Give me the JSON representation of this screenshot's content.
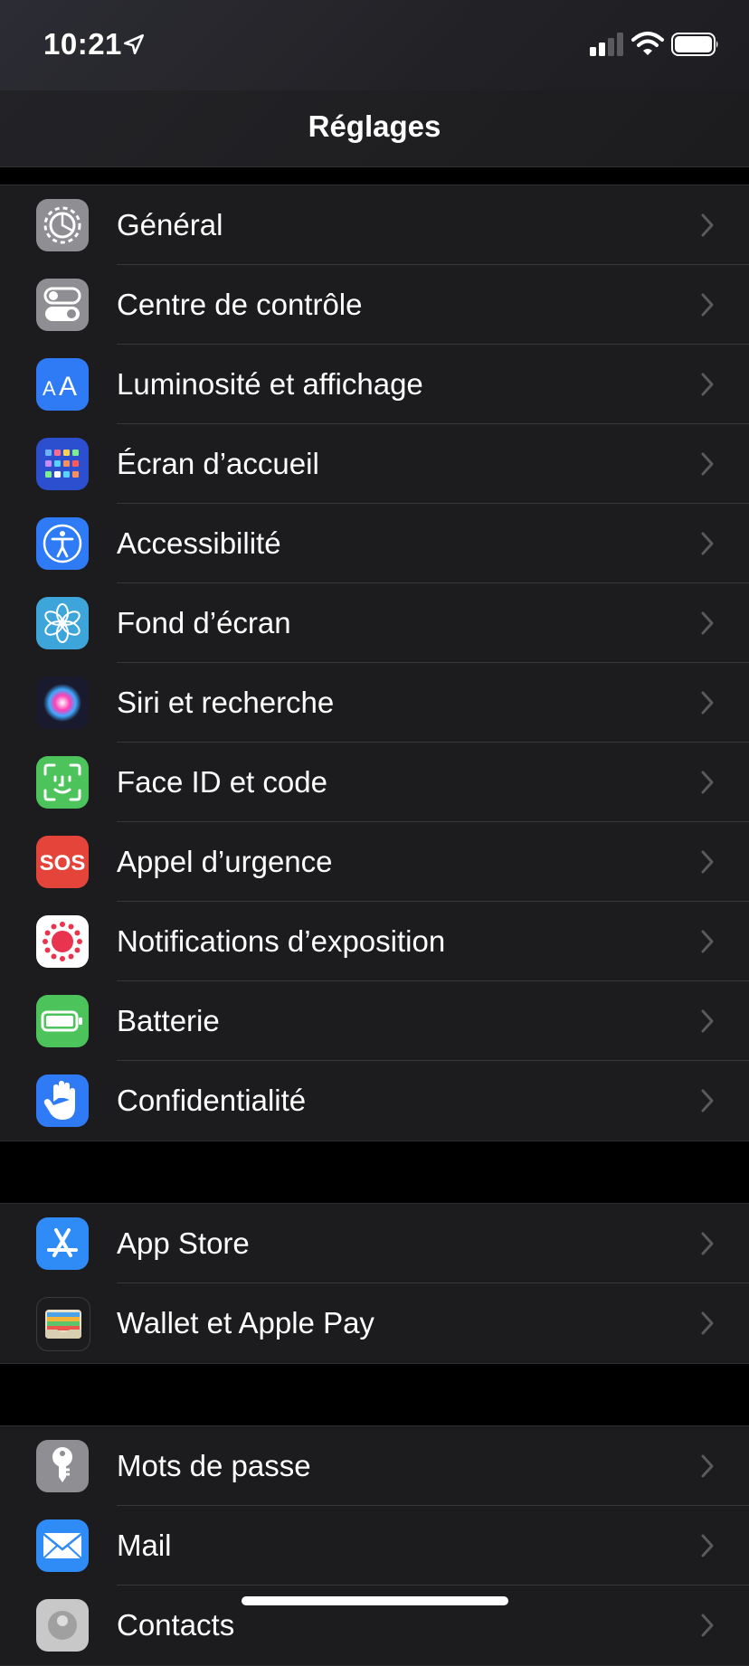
{
  "status": {
    "time": "10:21"
  },
  "nav": {
    "title": "Réglages"
  },
  "groups": [
    [
      {
        "label": "Général",
        "icon": "gear-icon",
        "color": "#8e8e93"
      },
      {
        "label": "Centre de contrôle",
        "icon": "toggles-icon",
        "color": "#8e8e93"
      },
      {
        "label": "Luminosité et affichage",
        "icon": "text-size-icon",
        "color": "#2f7bf5"
      },
      {
        "label": "Écran d’accueil",
        "icon": "home-grid-icon",
        "color": "#2c4fd0"
      },
      {
        "label": "Accessibilité",
        "icon": "accessibility-icon",
        "color": "#2f7bf5"
      },
      {
        "label": "Fond d’écran",
        "icon": "flower-icon",
        "color": "#3ea5da"
      },
      {
        "label": "Siri et recherche",
        "icon": "siri-icon",
        "color": "#1a1a2e"
      },
      {
        "label": "Face ID et code",
        "icon": "face-id-icon",
        "color": "#4cc35b"
      },
      {
        "label": "Appel d’urgence",
        "icon": "sos-icon",
        "color": "#e5443a"
      },
      {
        "label": "Notifications d’exposition",
        "icon": "exposure-icon",
        "color": "#ffffff"
      },
      {
        "label": "Batterie",
        "icon": "battery-icon",
        "color": "#4cc35b"
      },
      {
        "label": "Confidentialité",
        "icon": "hand-icon",
        "color": "#2f7bf5"
      }
    ],
    [
      {
        "label": "App Store",
        "icon": "app-store-icon",
        "color": "#2f8bf5"
      },
      {
        "label": "Wallet et Apple Pay",
        "icon": "wallet-icon",
        "color": "#1c1c1e"
      }
    ],
    [
      {
        "label": "Mots de passe",
        "icon": "key-icon",
        "color": "#8e8e93"
      },
      {
        "label": "Mail",
        "icon": "mail-icon",
        "color": "#2f8bf5"
      },
      {
        "label": "Contacts",
        "icon": "contacts-icon",
        "color": "#c8c8c8"
      }
    ]
  ]
}
